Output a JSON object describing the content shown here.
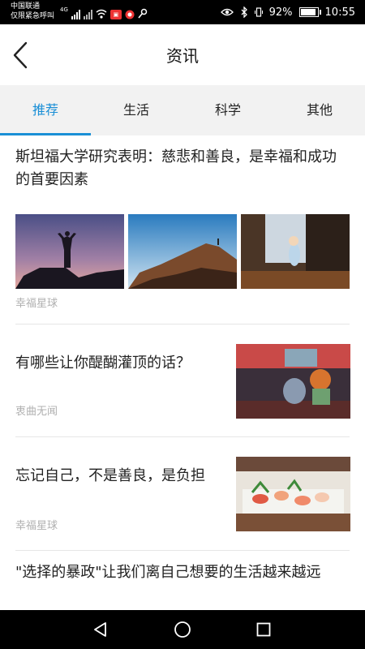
{
  "status_bar": {
    "carrier_line1": "中国联通",
    "carrier_line2": "仅限紧急呼叫",
    "network": "4G",
    "battery": "92%",
    "battery_level": 0.92,
    "time": "10:55"
  },
  "header": {
    "title": "资讯"
  },
  "tabs": [
    {
      "label": "推荐",
      "active": true
    },
    {
      "label": "生活",
      "active": false
    },
    {
      "label": "科学",
      "active": false
    },
    {
      "label": "其他",
      "active": false
    }
  ],
  "feed": [
    {
      "title": "斯坦福大学研究表明：慈悲和善良，是幸福和成功的首要因素",
      "source": "幸福星球"
    },
    {
      "title": "有哪些让你醍醐灌顶的话？",
      "source": "衷曲无闻"
    },
    {
      "title": "忘记自己，不是善良，是负担",
      "source": "幸福星球"
    },
    {
      "title": "\"选择的暴政\"让我们离自己想要的生活越来越远",
      "source": ""
    }
  ],
  "colors": {
    "accent": "#1a8fd6",
    "tab_bg": "#f2f2f2"
  },
  "icons": {
    "back": "chevron-left-icon",
    "nav_back": "triangle-back-icon",
    "nav_home": "circle-home-icon",
    "nav_recent": "square-recents-icon"
  }
}
